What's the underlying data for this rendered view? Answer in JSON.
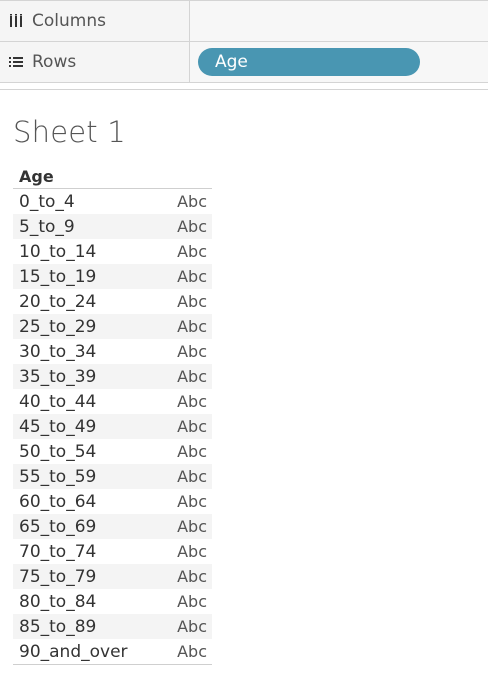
{
  "shelves": {
    "columns_label": "Columns",
    "rows_label": "Rows",
    "rows_pill": "Age"
  },
  "sheet": {
    "title": "Sheet 1"
  },
  "table": {
    "header": "Age",
    "rows": [
      {
        "label": "0_to_4",
        "value": "Abc"
      },
      {
        "label": "5_to_9",
        "value": "Abc"
      },
      {
        "label": "10_to_14",
        "value": "Abc"
      },
      {
        "label": "15_to_19",
        "value": "Abc"
      },
      {
        "label": "20_to_24",
        "value": "Abc"
      },
      {
        "label": "25_to_29",
        "value": "Abc"
      },
      {
        "label": "30_to_34",
        "value": "Abc"
      },
      {
        "label": "35_to_39",
        "value": "Abc"
      },
      {
        "label": "40_to_44",
        "value": "Abc"
      },
      {
        "label": "45_to_49",
        "value": "Abc"
      },
      {
        "label": "50_to_54",
        "value": "Abc"
      },
      {
        "label": "55_to_59",
        "value": "Abc"
      },
      {
        "label": "60_to_64",
        "value": "Abc"
      },
      {
        "label": "65_to_69",
        "value": "Abc"
      },
      {
        "label": "70_to_74",
        "value": "Abc"
      },
      {
        "label": "75_to_79",
        "value": "Abc"
      },
      {
        "label": "80_to_84",
        "value": "Abc"
      },
      {
        "label": "85_to_89",
        "value": "Abc"
      },
      {
        "label": "90_and_over",
        "value": "Abc"
      }
    ]
  },
  "icons": {
    "columns": "columns-icon",
    "rows": "rows-icon"
  },
  "colors": {
    "pill": "#4996b2",
    "shelf_bg": "#f5f5f5",
    "border": "#d4d4d4"
  }
}
